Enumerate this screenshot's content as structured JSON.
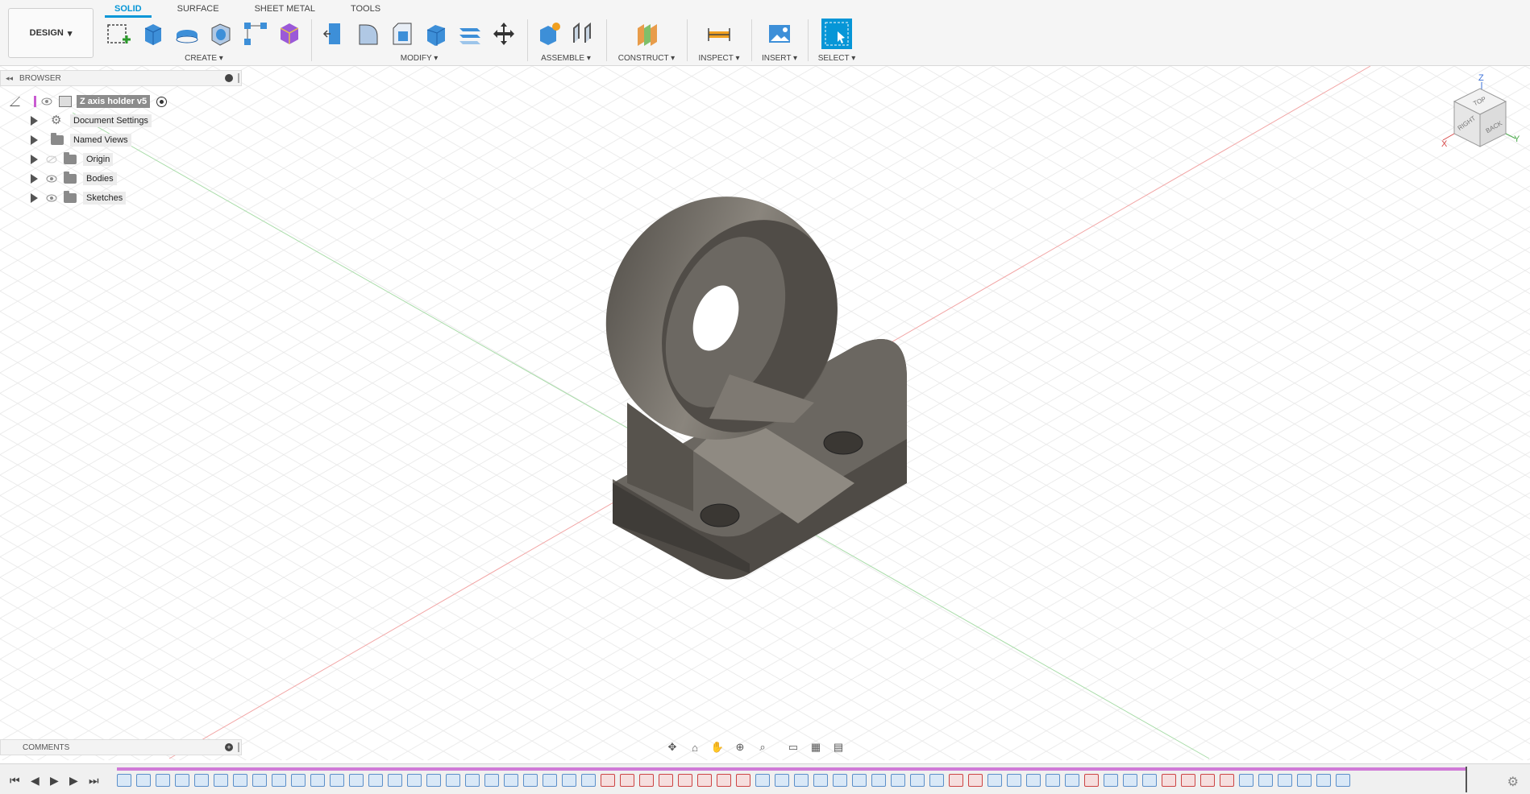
{
  "toolbar": {
    "design_label": "DESIGN",
    "tabs": [
      "SOLID",
      "SURFACE",
      "SHEET METAL",
      "TOOLS"
    ],
    "groups": {
      "create": "CREATE",
      "modify": "MODIFY",
      "assemble": "ASSEMBLE",
      "construct": "CONSTRUCT",
      "inspect": "INSPECT",
      "insert": "INSERT",
      "select": "SELECT"
    }
  },
  "browser": {
    "title": "BROWSER",
    "root": "Z axis holder v5",
    "items": [
      "Document Settings",
      "Named Views",
      "Origin",
      "Bodies",
      "Sketches"
    ]
  },
  "comments": {
    "title": "COMMENTS"
  },
  "viewcube": {
    "z": "Z",
    "x": "X",
    "y": "Y",
    "faces": [
      "TOP",
      "RIGHT",
      "BACK"
    ]
  },
  "colors": {
    "accent": "#0696d7",
    "timeline": "#d07ad7",
    "model": "#6b6761"
  }
}
